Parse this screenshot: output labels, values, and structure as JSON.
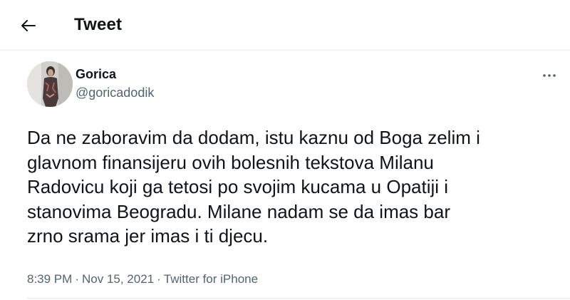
{
  "header": {
    "title": "Tweet",
    "back_icon": "arrow-left-icon"
  },
  "tweet": {
    "author": {
      "name": "Gorica",
      "handle": "@goricadodik",
      "avatar_icon": "profile-photo"
    },
    "more_icon": "more-dots-icon",
    "text": "Da ne zaboravim da dodam, istu kaznu od Boga zelim i\nglavnom finansijeru ovih bolesnih tekstova Milanu\nRadovicu koji ga tetosi po svojim kucama u Opatiji i\nstanovima Beogradu. Milane nadam se da imas bar\nzrno srama jer imas i ti djecu.",
    "meta": {
      "time": "8:39 PM",
      "separator": "·",
      "date": "Nov 15, 2021",
      "source": "Twitter for iPhone"
    }
  },
  "colors": {
    "text_primary": "#0f1419",
    "text_secondary": "#536471",
    "divider": "#e6ecf0"
  }
}
